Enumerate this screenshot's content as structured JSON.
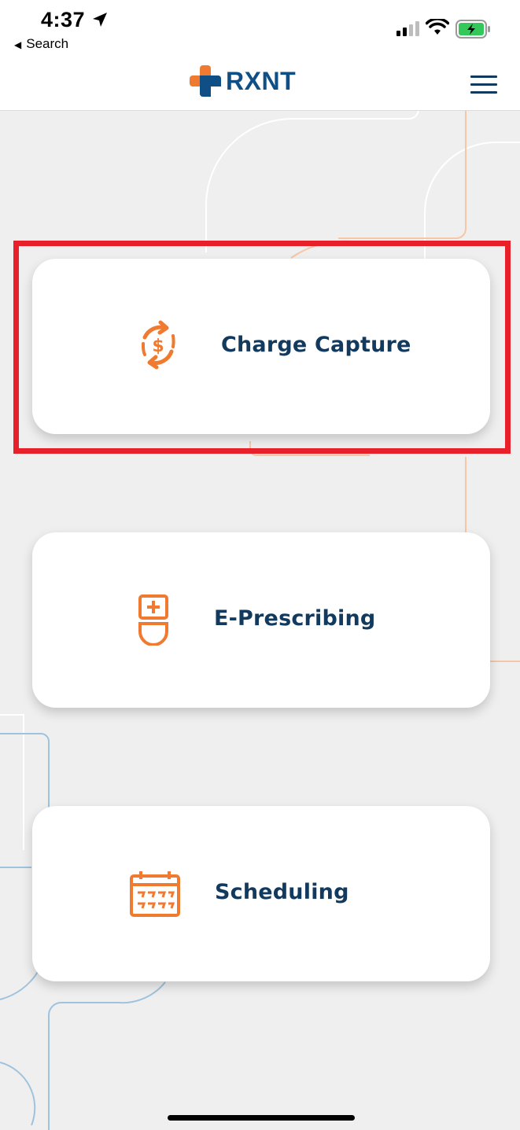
{
  "status_bar": {
    "time": "4:37",
    "back_label": "Search"
  },
  "header": {
    "brand": "RXNT",
    "brand_colors": {
      "blue": "#0f4f86",
      "orange": "#f07a2f"
    }
  },
  "cards": [
    {
      "label": "Charge Capture",
      "icon": "dollar-cycle-icon"
    },
    {
      "label": "E-Prescribing",
      "icon": "prescription-icon"
    },
    {
      "label": "Scheduling",
      "icon": "calendar-icon"
    }
  ],
  "colors": {
    "accent": "#f07a2f",
    "text": "#123a5e",
    "highlight": "#e8202a",
    "background": "#efefef"
  }
}
